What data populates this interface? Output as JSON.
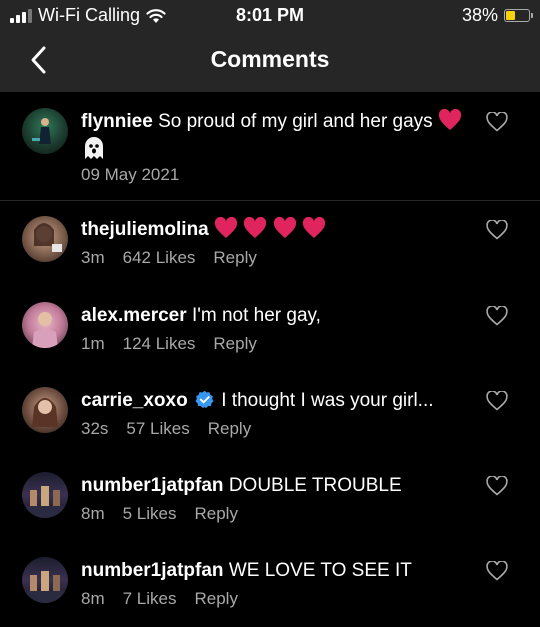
{
  "status_bar": {
    "carrier": "Wi-Fi Calling",
    "time": "8:01 PM",
    "battery": "38%",
    "battery_level": 0.38,
    "battery_color": "#f5d20a"
  },
  "header": {
    "title": "Comments",
    "back_icon": "chevron-left-icon"
  },
  "caption": {
    "username": "flynniee",
    "text": "So proud of my girl and her gays",
    "emojis": [
      "red-heart",
      "ghost"
    ],
    "date": "09 May 2021"
  },
  "comments": [
    {
      "username": "thejuliemolina",
      "text": "",
      "emojis": [
        "red-heart",
        "red-heart",
        "red-heart",
        "red-heart"
      ],
      "time": "3m",
      "likes": "642 Likes",
      "reply": "Reply"
    },
    {
      "username": "alex.mercer",
      "text": "I'm not her gay,",
      "time": "1m",
      "likes": "124 Likes",
      "reply": "Reply"
    },
    {
      "username": "carrie_xoxo",
      "verified": true,
      "text": "I thought I was your girl...",
      "time": "32s",
      "likes": "57 Likes",
      "reply": "Reply"
    },
    {
      "username": "number1jatpfan",
      "text": "DOUBLE TROUBLE",
      "time": "8m",
      "likes": "5 Likes",
      "reply": "Reply"
    },
    {
      "username": "number1jatpfan",
      "text": "WE LOVE TO SEE IT",
      "time": "8m",
      "likes": "7 Likes",
      "reply": "Reply"
    }
  ],
  "colors": {
    "header_bg": "#262626",
    "secondary_text": "#a8a8a8",
    "verified_blue": "#3897f0",
    "heart_red": "#e0245e"
  }
}
